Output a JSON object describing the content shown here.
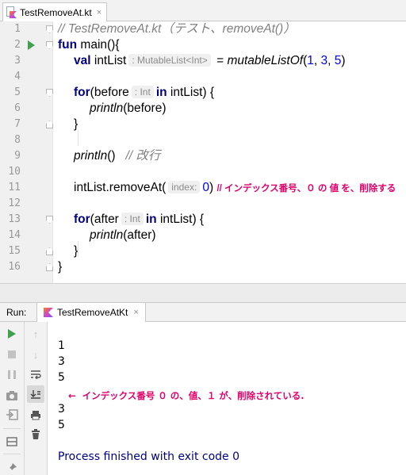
{
  "editor_tab": {
    "filename": "TestRemoveAt.kt",
    "close": "×"
  },
  "lines": {
    "l1": {
      "num": "1",
      "comment": "// TestRemoveAt.kt（テスト、removeAt()）"
    },
    "l2": {
      "num": "2",
      "kw": "fun",
      "text": " main(){"
    },
    "l3": {
      "num": "3",
      "kw": "val",
      "name": " intList",
      "hint": ": MutableList<Int>",
      "eq": " = ",
      "fn": "mutableListOf",
      "open": "(",
      "a": "1",
      "c1": ", ",
      "b": "3",
      "c2": ", ",
      "c": "5",
      "close": ")"
    },
    "l4": {
      "num": "4"
    },
    "l5": {
      "num": "5",
      "kw": "for",
      "pre": "(before",
      "hint": ": Int",
      "kw2": "in",
      "post": " intList) {"
    },
    "l6": {
      "num": "6",
      "fn": "println",
      "args": "(before)"
    },
    "l7": {
      "num": "7",
      "text": "}"
    },
    "l8": {
      "num": "8"
    },
    "l9": {
      "num": "9",
      "fn": "println",
      "args": "()",
      "comment": "// 改行"
    },
    "l10": {
      "num": "10"
    },
    "l11": {
      "num": "11",
      "pre": "intList.removeAt(",
      "hint": "index:",
      "arg": "0",
      "close": ")",
      "anno": "// インデックス番号、０ の 値 を、削除する"
    },
    "l12": {
      "num": "12"
    },
    "l13": {
      "num": "13",
      "kw": "for",
      "pre": "(after",
      "hint": ": Int",
      "kw2": "in",
      "post": " intList) {"
    },
    "l14": {
      "num": "14",
      "fn": "println",
      "args": "(after)"
    },
    "l15": {
      "num": "15",
      "text": "}"
    },
    "l16": {
      "num": "16",
      "text": "}"
    }
  },
  "run_window": {
    "label": "Run:",
    "tab_name": "TestRemoveAtKt",
    "tab_close": "×",
    "output": [
      "1",
      "3",
      "5",
      "3",
      "5"
    ],
    "annotation": "←  インデックス番号 ０ の、値、１ が、削除されている.",
    "exit_message": "Process finished with exit code 0"
  }
}
